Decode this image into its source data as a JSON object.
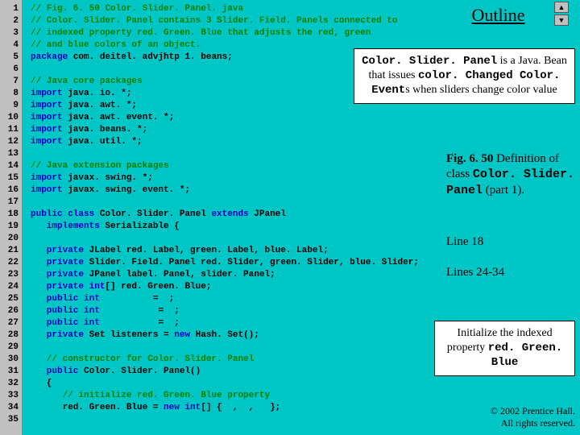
{
  "outline": "Outline",
  "callout1_a": "Color. Slider. Panel",
  "callout1_b": " is a Java. Bean that issues ",
  "callout1_c": "color. Changed Color. Event",
  "callout1_d": "s when sliders change color value",
  "fig_a": "Fig. 6. 50",
  "fig_b": "   Definition of class ",
  "fig_c": "Color. Slider. Panel",
  "fig_d": " (part 1).",
  "line18": "Line 18",
  "lines24": "Lines 24-34",
  "callout2_a": "Initialize the indexed property ",
  "callout2_b": "red. Green. Blue",
  "copy1": "© 2002 Prentice Hall.",
  "copy2": "All rights reserved.",
  "nav_up": "▲",
  "nav_dn": "▼",
  "ln": {
    "1": "1",
    "2": "2",
    "3": "3",
    "4": "4",
    "5": "5",
    "6": "6",
    "7": "7",
    "8": "8",
    "9": "9",
    "10": "10",
    "11": "11",
    "12": "12",
    "13": "13",
    "14": "14",
    "15": "15",
    "16": "16",
    "17": "17",
    "18": "18",
    "19": "19",
    "20": "20",
    "21": "21",
    "22": "22",
    "23": "23",
    "24": "24",
    "25": "25",
    "26": "26",
    "27": "27",
    "28": "28",
    "29": "29",
    "30": "30",
    "31": "31",
    "32": "32",
    "33": "33",
    "34": "34",
    "35": "35"
  },
  "c": {
    "l1": "// Fig. 6. 50 Color. Slider. Panel. java",
    "l2": "// Color. Slider. Panel contains 3 Slider. Field. Panels connected to",
    "l3": "// indexed property red. Green. Blue that adjusts the red, green",
    "l4": "// and blue colors of an object.",
    "l5a": "package",
    "l5b": " com. deitel. advjhtp 1. beans;",
    "l7": "// Java core packages",
    "l8a": "import",
    "l8b": " java. io. *;",
    "l9a": "import",
    "l9b": " java. awt. *;",
    "l10a": "import",
    "l10b": " java. awt. event. *;",
    "l11a": "import",
    "l11b": " java. beans. *;",
    "l12a": "import",
    "l12b": " java. util. *;",
    "l14": "// Java extension packages",
    "l15a": "import",
    "l15b": " javax. swing. *;",
    "l16a": "import",
    "l16b": " javax. swing. event. *;",
    "l18a": "public class",
    "l18b": " Color. Slider. Panel ",
    "l18c": "extends",
    "l18d": " JPanel",
    "l19a": "   implements",
    "l19b": " Serializable {",
    "l21a": "   private",
    "l21b": " JLabel red. Label, green. Label, blue. Label;",
    "l22a": "   private",
    "l22b": " Slider. Field. Panel red. Slider, green. Slider, blue. Slider;",
    "l23a": "   private",
    "l23b": " JPanel label. Panel, slider. Panel;",
    "l24a": "   private int",
    "l24b": "[] red. Green. Blue;",
    "l25a": "   public int",
    "l25b": "          =  ;",
    "l26a": "   public int",
    "l26b": "           =  ;",
    "l27a": "   public int",
    "l27b": "           =  ;",
    "l28a": "   private ",
    "l28b": "Set listeners = ",
    "l28c": "new",
    "l28d": " Hash. Set();",
    "l30": "   // constructor for Color. Slider. Panel",
    "l31a": "   public",
    "l31b": " Color. Slider. Panel()",
    "l32": "   {",
    "l33": "      // initialize red. Green. Blue property",
    "l34a": "      red. Green. Blue = ",
    "l34b": "new int",
    "l34c": "[] {  ,  ,   };"
  }
}
